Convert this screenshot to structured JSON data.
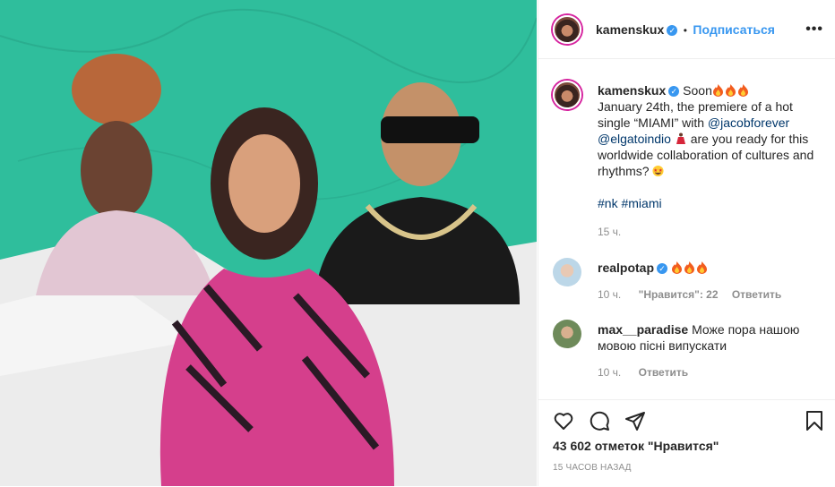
{
  "post": {
    "author": "kamenskux",
    "subscribe_label": "Подписаться",
    "separator": "•",
    "more_label": "•••",
    "caption_soon": "Soon",
    "caption_line1": "January 24th, the premiere of a hot single “MIAMI” with ",
    "mention1": "@jacobforever",
    "mention2": "@elgatoindio",
    "caption_line2": " are you ready for this worldwide collaboration of cultures and rhythms? ",
    "hashtag1": "#nk",
    "hashtag2": "#miami",
    "caption_age": "15 ч."
  },
  "comments": [
    {
      "user": "realpotap",
      "text": "",
      "age": "10 ч.",
      "likes": "\"Нравится\": 22",
      "reply": "Ответить"
    },
    {
      "user": "max__paradise",
      "text": "Може пора нашою мовою пісні випускати",
      "age": "10 ч.",
      "reply": "Ответить"
    }
  ],
  "footer": {
    "likes_text": "43 602 отметок \"Нравится\"",
    "timestamp": "15 ЧАСОВ НАЗАД"
  },
  "icons": [
    "heart-icon",
    "comment-icon",
    "share-icon",
    "bookmark-icon",
    "verified-icon",
    "fire-emoji",
    "dancer-emoji",
    "star-eyes-emoji"
  ],
  "colors": {
    "accent": "#3897f0",
    "link": "#00376b",
    "muted": "#8e8e8e",
    "teal": "#2fbe9c"
  }
}
